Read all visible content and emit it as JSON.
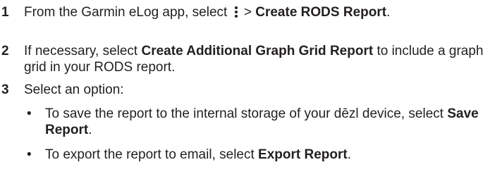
{
  "steps": [
    {
      "number": "1",
      "pre": "From the Garmin eLog app, select",
      "menu_icon": "vertical-ellipsis-menu-icon",
      "mid": "> ",
      "bold": "Create RODS Report",
      "post": "."
    },
    {
      "number": "2",
      "pre": "If necessary, select ",
      "bold": "Create Additional Graph Grid Report",
      "post": " to include a graph grid in your RODS report."
    },
    {
      "number": "3",
      "text": "Select an option:"
    }
  ],
  "options": [
    {
      "bullet": "•",
      "pre": "To save the report to the internal storage of your dēzl device, select ",
      "bold": "Save Report",
      "post": "."
    },
    {
      "bullet": "•",
      "pre": "To export the report to email, select ",
      "bold": "Export Report",
      "post": "."
    }
  ]
}
